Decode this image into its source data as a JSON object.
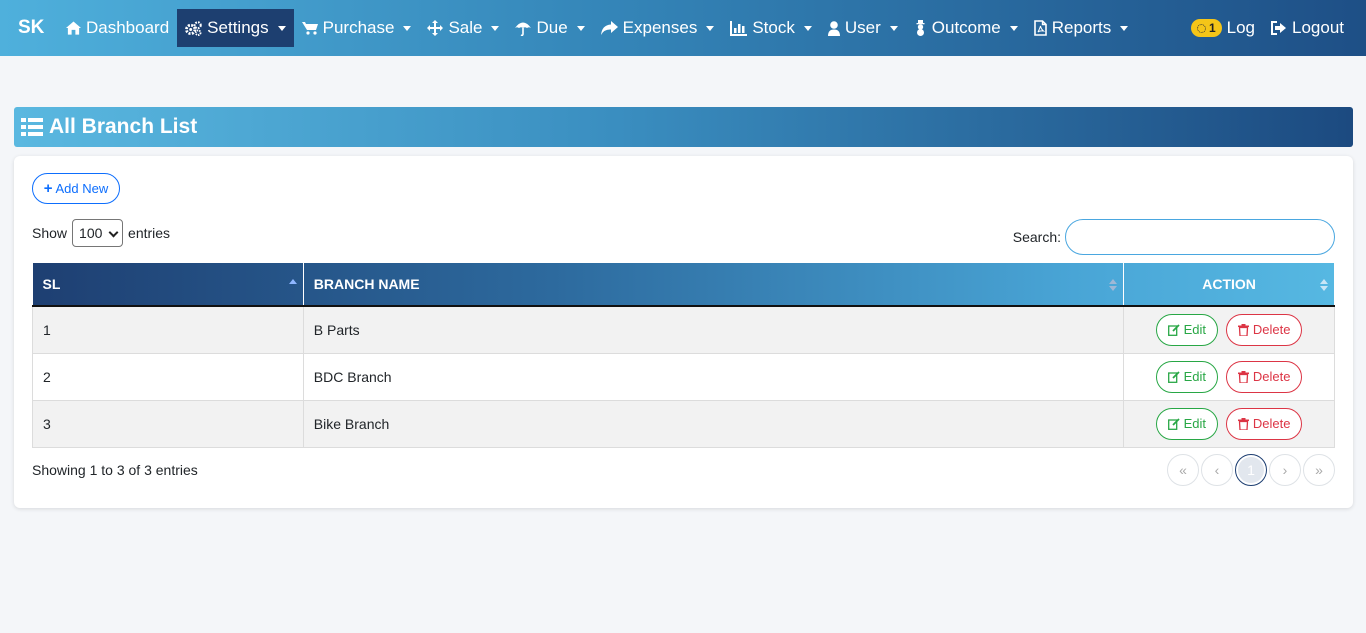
{
  "nav": {
    "brand": "SK",
    "items": [
      {
        "label": "Dashboard",
        "icon": "home-icon",
        "dropdown": false
      },
      {
        "label": "Settings",
        "icon": "gears-icon",
        "dropdown": true,
        "active": true
      },
      {
        "label": "Purchase",
        "icon": "cart-icon",
        "dropdown": true
      },
      {
        "label": "Sale",
        "icon": "arrows-move-icon",
        "dropdown": true
      },
      {
        "label": "Due",
        "icon": "umbrella-icon",
        "dropdown": true
      },
      {
        "label": "Expenses",
        "icon": "share-arrow-icon",
        "dropdown": true
      },
      {
        "label": "Stock",
        "icon": "bar-chart-icon",
        "dropdown": true
      },
      {
        "label": "User",
        "icon": "user-icon",
        "dropdown": true
      },
      {
        "label": "Outcome",
        "icon": "snowman-icon",
        "dropdown": true
      },
      {
        "label": "Reports",
        "icon": "pdf-file-icon",
        "dropdown": true
      }
    ],
    "badge_count": "1",
    "log_label": "Log",
    "logout_label": "Logout"
  },
  "page": {
    "title": "All Branch List"
  },
  "controls": {
    "add_new_label": "Add New",
    "show_label": "Show",
    "entries_label": "entries",
    "page_size": "100",
    "search_label": "Search:",
    "search_value": ""
  },
  "table": {
    "columns": [
      "SL",
      "BRANCH NAME",
      "ACTION"
    ],
    "rows": [
      {
        "sl": "1",
        "name": "B Parts"
      },
      {
        "sl": "2",
        "name": "BDC Branch"
      },
      {
        "sl": "3",
        "name": "Bike Branch"
      }
    ],
    "edit_label": "Edit",
    "delete_label": "Delete"
  },
  "footer": {
    "info": "Showing 1 to 3 of 3 entries",
    "pager": [
      "«",
      "‹",
      "1",
      "›",
      "»"
    ],
    "current_page": "1"
  },
  "colors": {
    "accent": "#0d6efd",
    "edit": "#28a745",
    "delete": "#dc3545",
    "nav_dark": "#1d3f70"
  }
}
